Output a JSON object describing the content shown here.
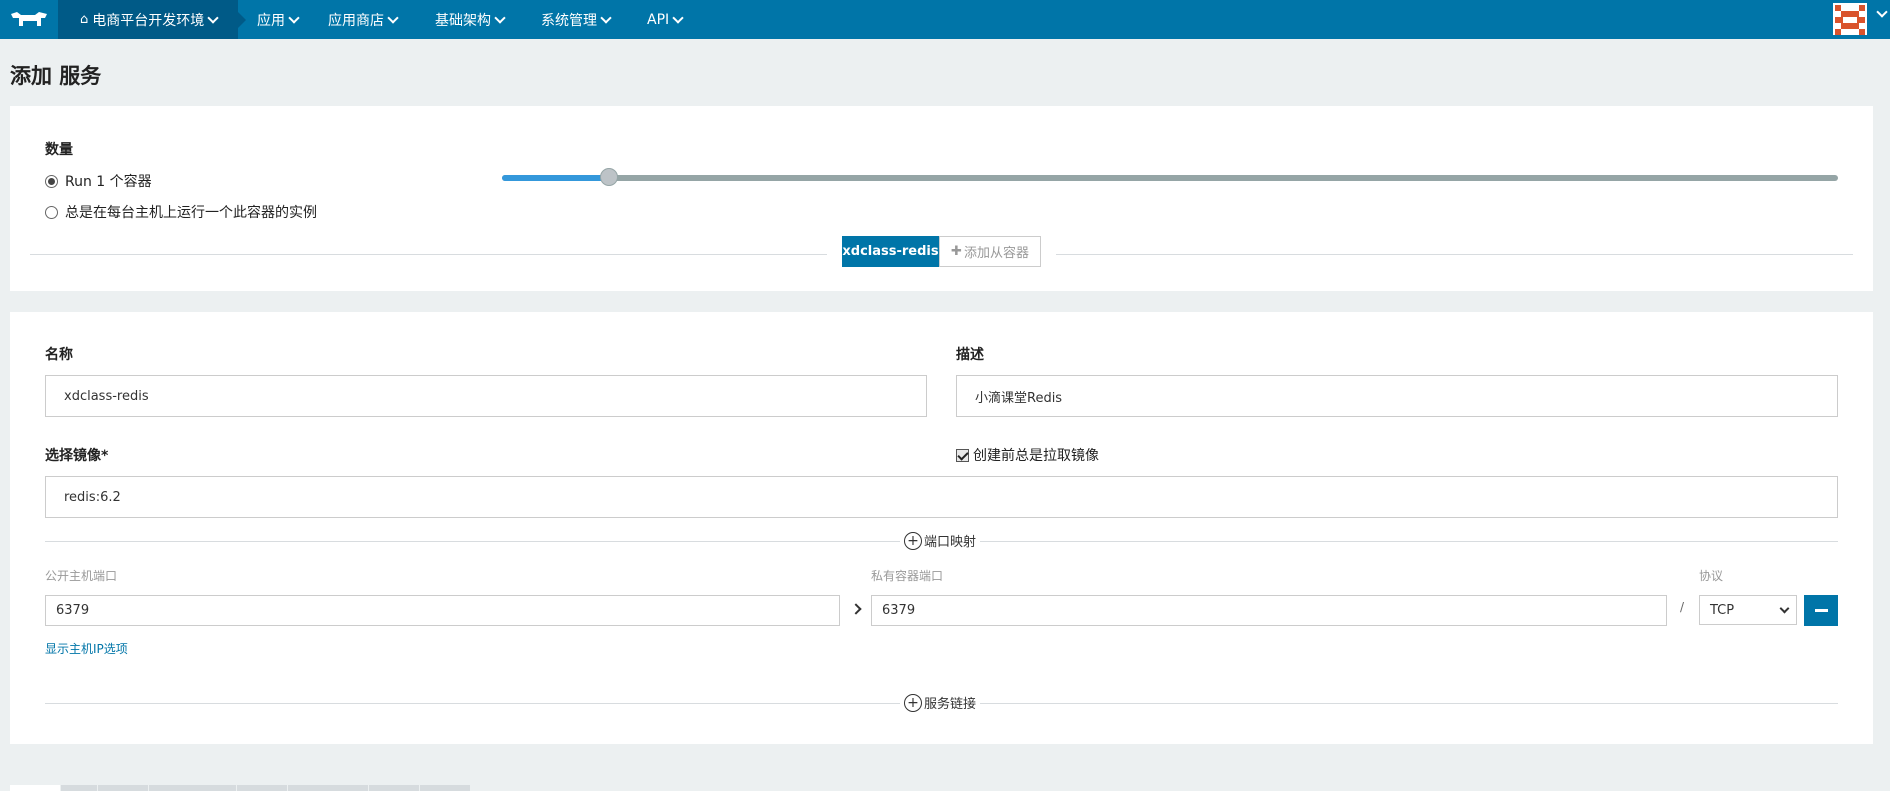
{
  "nav": {
    "environment": "电商平台开发环境",
    "items": [
      "应用",
      "应用商店",
      "基础架构",
      "系统管理",
      "API"
    ]
  },
  "page_title": "添加 服务",
  "scale": {
    "label": "数量",
    "run_option": "Run 1 个容器",
    "global_option": "总是在每台主机上运行一个此容器的实例",
    "slider_value": 1
  },
  "containers": {
    "active_tab": "xdclass-redis",
    "add_sidekick": "添加从容器"
  },
  "form": {
    "name_label": "名称",
    "name_value": "xdclass-redis",
    "desc_label": "描述",
    "desc_value": "小滴课堂Redis",
    "image_label": "选择镜像*",
    "image_value": "redis:6.2",
    "always_pull_label": "创建前总是拉取镜像"
  },
  "ports": {
    "section_label": "端口映射",
    "public_label": "公开主机端口",
    "private_label": "私有容器端口",
    "protocol_label": "协议",
    "public_value": "6379",
    "private_value": "6379",
    "slash": "/",
    "protocol_value": "TCP",
    "show_ip_link": "显示主机IP选项"
  },
  "links": {
    "section_label": "服务链接"
  },
  "colors": {
    "nav_bg": "#0075a8",
    "nav_active": "#005a87",
    "accent": "#3498db"
  }
}
